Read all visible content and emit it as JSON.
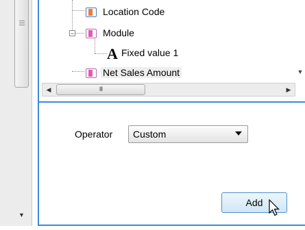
{
  "tree": {
    "items": [
      {
        "label": "Location Code",
        "icon": "field-icon"
      },
      {
        "label": "Module",
        "icon": "field-icon"
      },
      {
        "label": "Fixed value 1",
        "icon": "text-a-icon"
      },
      {
        "label": "Net Sales Amount",
        "icon": "field-icon"
      }
    ],
    "hscroll_thumb_glyph": "III"
  },
  "form": {
    "operator_label": "Operator",
    "operator_selected": "Custom",
    "add_label": "Add"
  },
  "colors": {
    "accent_border": "#3c89d8",
    "button_border": "#4f8fc9"
  }
}
